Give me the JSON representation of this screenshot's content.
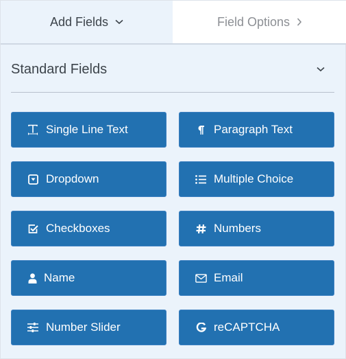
{
  "tabs": {
    "add_fields": {
      "label": "Add Fields",
      "icon": "chevron-down-icon",
      "active": true
    },
    "field_options": {
      "label": "Field Options",
      "icon": "chevron-right-icon",
      "active": false
    }
  },
  "section": {
    "title": "Standard Fields",
    "toggle_icon": "chevron-down-icon",
    "expanded": true
  },
  "fields": [
    {
      "label": "Single Line Text",
      "icon": "text-cursor-icon"
    },
    {
      "label": "Paragraph Text",
      "icon": "paragraph-icon"
    },
    {
      "label": "Dropdown",
      "icon": "dropdown-icon"
    },
    {
      "label": "Multiple Choice",
      "icon": "list-icon"
    },
    {
      "label": "Checkboxes",
      "icon": "checkbox-icon"
    },
    {
      "label": "Numbers",
      "icon": "hash-icon"
    },
    {
      "label": "Name",
      "icon": "user-icon"
    },
    {
      "label": "Email",
      "icon": "envelope-icon"
    },
    {
      "label": "Number Slider",
      "icon": "sliders-icon"
    },
    {
      "label": "reCAPTCHA",
      "icon": "google-icon"
    }
  ],
  "colors": {
    "button_bg": "#2271b1",
    "panel_bg": "#ebf3fb",
    "text_dark": "#3c434a",
    "text_muted": "#8c8f94"
  }
}
